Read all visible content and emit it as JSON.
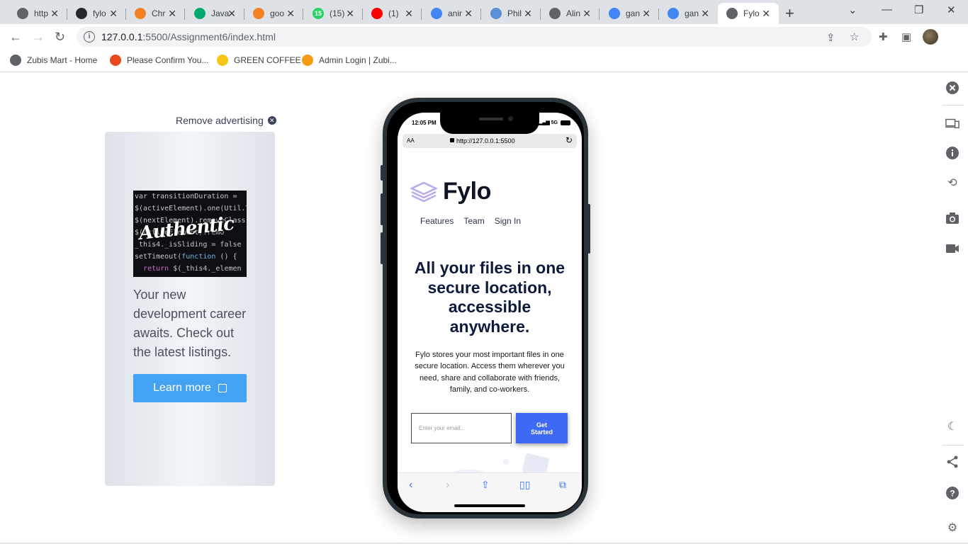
{
  "browser": {
    "tabs": [
      {
        "title": "http",
        "favicon": "globe-icon",
        "color": "#5f6368"
      },
      {
        "title": "fylo",
        "favicon": "github-icon",
        "color": "#24292e"
      },
      {
        "title": "Chr",
        "favicon": "stackoverflow-icon",
        "color": "#f48024"
      },
      {
        "title": "Java",
        "favicon": "w3schools-icon",
        "color": "#04aa6d"
      },
      {
        "title": "goo",
        "favicon": "stackoverflow-icon",
        "color": "#f48024"
      },
      {
        "title": "(15)",
        "favicon": "whatsapp-icon",
        "color": "#25d366",
        "badge": "15"
      },
      {
        "title": "(1)",
        "favicon": "youtube-icon",
        "color": "#ff0000"
      },
      {
        "title": "anir",
        "favicon": "google-icon",
        "color": "#4285f4"
      },
      {
        "title": "Phil",
        "favicon": "cloud-icon",
        "color": "#5b8fd6"
      },
      {
        "title": "Alin",
        "favicon": "globe-icon",
        "color": "#5f6368"
      },
      {
        "title": "gan",
        "favicon": "google-icon",
        "color": "#4285f4"
      },
      {
        "title": "gan",
        "favicon": "google-icon",
        "color": "#4285f4"
      },
      {
        "title": "Fylo",
        "favicon": "globe-icon",
        "color": "#5f6368",
        "active": true
      }
    ],
    "url_host": "127.0.0.1",
    "url_rest": ":5500/Assignment6/index.html",
    "bookmarks": [
      {
        "label": "Zubis Mart - Home",
        "icon": "globe-icon",
        "color": "#5f6368"
      },
      {
        "label": "Please Confirm You...",
        "icon": "shop-icon",
        "color": "#e8491d"
      },
      {
        "label": "GREEN COFFEE",
        "icon": "smiley-icon",
        "color": "#f5c518"
      },
      {
        "label": "Admin Login | Zubi...",
        "icon": "flame-icon",
        "color": "#f39c12"
      }
    ]
  },
  "ad": {
    "remove_label": "Remove advertising",
    "image_brand": "Authentic",
    "body": "Your new development career awaits. Check out the latest listings.",
    "button_label": "Learn more"
  },
  "phone": {
    "time": "12:05 PM",
    "network": "5G",
    "text_size_label": "AA",
    "url": "http://127.0.0.1:5500",
    "site": {
      "brand": "Fylo",
      "nav": [
        "Features",
        "Team",
        "Sign In"
      ],
      "headline": "All your files in one secure location, accessible anywhere.",
      "description": "Fylo stores your most important files in one secure location. Access them wherever you need, share and collaborate with friends, family, and co-workers.",
      "email_placeholder": "Enter your email...",
      "cta_label": "Get Started"
    }
  },
  "side_panel": [
    "close-icon",
    "devices-icon",
    "info-icon",
    "rotate-icon",
    "camera-icon",
    "video-icon",
    "dark-mode-icon",
    "share-icon",
    "help-icon",
    "settings-icon"
  ]
}
